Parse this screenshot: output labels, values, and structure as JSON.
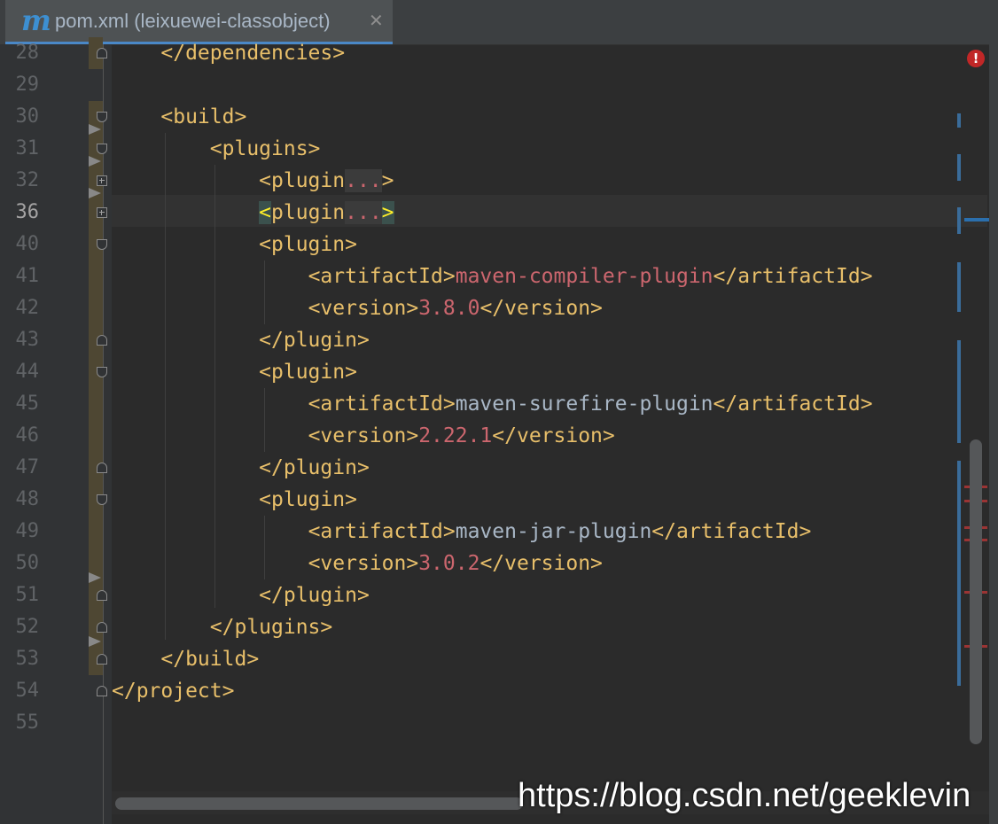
{
  "tab": {
    "icon_letter": "m",
    "title": "pom.xml (leixuewei-classobject)",
    "close": "✕"
  },
  "gutter": {
    "line_numbers": [
      "28",
      "29",
      "30",
      "31",
      "32",
      "36",
      "40",
      "41",
      "42",
      "43",
      "44",
      "45",
      "46",
      "47",
      "48",
      "49",
      "50",
      "51",
      "52",
      "53",
      "54",
      "55"
    ],
    "current_line": "36"
  },
  "code": {
    "l28": {
      "open": "</dependencies>"
    },
    "l30": {
      "open": "<build>"
    },
    "l31": {
      "open": "<plugins>"
    },
    "l32": {
      "open": "<plugin",
      "dots": "...",
      "close": ">"
    },
    "l36": {
      "open_bracket": "<",
      "open_name": "plugin",
      "dots": "...",
      "close": ">"
    },
    "l40": {
      "open": "<plugin>"
    },
    "l41": {
      "open": "<artifactId>",
      "value": "maven-compiler-plugin",
      "close": "</artifactId>"
    },
    "l42": {
      "open": "<version>",
      "value": "3.8.0",
      "close": "</version>"
    },
    "l43": {
      "open": "</plugin>"
    },
    "l44": {
      "open": "<plugin>"
    },
    "l45": {
      "open": "<artifactId>",
      "value": "maven-surefire-plugin",
      "close": "</artifactId>"
    },
    "l46": {
      "open": "<version>",
      "value": "2.22.1",
      "close": "</version>"
    },
    "l47": {
      "open": "</plugin>"
    },
    "l48": {
      "open": "<plugin>"
    },
    "l49": {
      "open": "<artifactId>",
      "value": "maven-jar-plugin",
      "close": "</artifactId>"
    },
    "l50": {
      "open": "<version>",
      "value": "3.0.2",
      "close": "</version>"
    },
    "l51": {
      "open": "</plugin>"
    },
    "l52": {
      "open": "</plugins>"
    },
    "l53": {
      "open": "</build>"
    },
    "l54": {
      "open": "</project>"
    }
  },
  "status": {
    "error_icon": "!"
  },
  "watermark": "https://blog.csdn.net/geeklevin",
  "colors": {
    "tag": "#e8bf6a",
    "value": "#cc666e",
    "text": "#a9b7c6",
    "background": "#2b2b2b",
    "error": "#c12727",
    "tab_underline": "#4a88c7"
  }
}
